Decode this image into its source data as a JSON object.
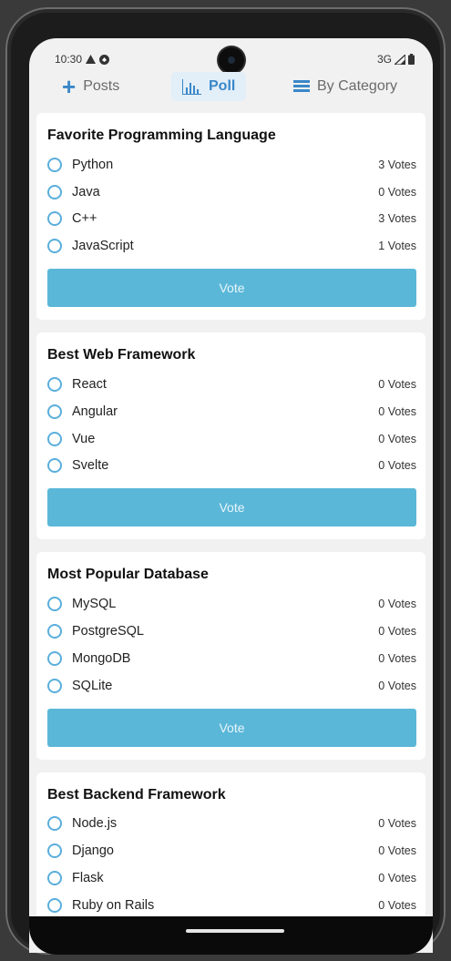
{
  "status_bar": {
    "time": "10:30",
    "network": "3G"
  },
  "tabs": [
    {
      "label": "Posts",
      "icon": "plus-icon",
      "active": false
    },
    {
      "label": "Poll",
      "icon": "bar-chart-icon",
      "active": true
    },
    {
      "label": "By Category",
      "icon": "list-icon",
      "active": false
    }
  ],
  "polls": [
    {
      "title": "Favorite Programming Language",
      "options": [
        {
          "label": "Python",
          "votes": "3 Votes"
        },
        {
          "label": "Java",
          "votes": "0 Votes"
        },
        {
          "label": "C++",
          "votes": "3 Votes"
        },
        {
          "label": "JavaScript",
          "votes": "1 Votes"
        }
      ],
      "button": "Vote"
    },
    {
      "title": "Best Web Framework",
      "options": [
        {
          "label": "React",
          "votes": "0 Votes"
        },
        {
          "label": "Angular",
          "votes": "0 Votes"
        },
        {
          "label": "Vue",
          "votes": "0 Votes"
        },
        {
          "label": "Svelte",
          "votes": "0 Votes"
        }
      ],
      "button": "Vote"
    },
    {
      "title": "Most Popular Database",
      "options": [
        {
          "label": "MySQL",
          "votes": "0 Votes"
        },
        {
          "label": "PostgreSQL",
          "votes": "0 Votes"
        },
        {
          "label": "MongoDB",
          "votes": "0 Votes"
        },
        {
          "label": "SQLite",
          "votes": "0 Votes"
        }
      ],
      "button": "Vote"
    },
    {
      "title": "Best Backend Framework",
      "options": [
        {
          "label": "Node.js",
          "votes": "0 Votes"
        },
        {
          "label": "Django",
          "votes": "0 Votes"
        },
        {
          "label": "Flask",
          "votes": "0 Votes"
        },
        {
          "label": "Ruby on Rails",
          "votes": "0 Votes"
        }
      ],
      "button": "Vote"
    }
  ],
  "colors": {
    "accent": "#3a87c8",
    "vote_button": "#5bb7d8",
    "radio": "#5aaedc"
  }
}
